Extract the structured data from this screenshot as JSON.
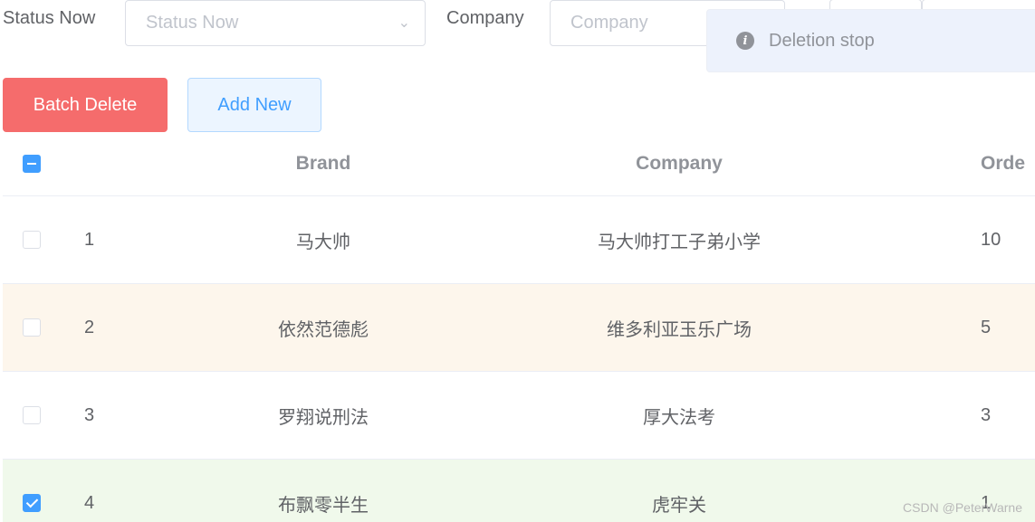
{
  "filters": {
    "status_label": "Status Now",
    "status_placeholder": "Status Now",
    "company_label": "Company",
    "company_placeholder": "Company"
  },
  "toast": {
    "message": "Deletion stop",
    "icon": "info-icon"
  },
  "actions": {
    "batch_delete": "Batch Delete",
    "add_new": "Add New"
  },
  "table": {
    "columns": {
      "brand": "Brand",
      "company": "Company",
      "ordered": "Orde"
    },
    "rows": [
      {
        "index": "1",
        "brand": "马大帅",
        "company": "马大帅打工子弟小学",
        "ordered": "10",
        "checked": false,
        "style": "normal"
      },
      {
        "index": "2",
        "brand": "依然范德彪",
        "company": "维多利亚玉乐广场",
        "ordered": "5",
        "checked": false,
        "style": "warning"
      },
      {
        "index": "3",
        "brand": "罗翔说刑法",
        "company": "厚大法考",
        "ordered": "3",
        "checked": false,
        "style": "normal"
      },
      {
        "index": "4",
        "brand": "布飘零半生",
        "company": "虎牢关",
        "ordered": "1",
        "checked": true,
        "style": "success"
      }
    ]
  },
  "watermark": "CSDN @PeterWarne",
  "colors": {
    "danger": "#f56c6c",
    "primary": "#409eff",
    "warning_row": "#fdf6ec",
    "success_row": "#f0f9eb"
  }
}
